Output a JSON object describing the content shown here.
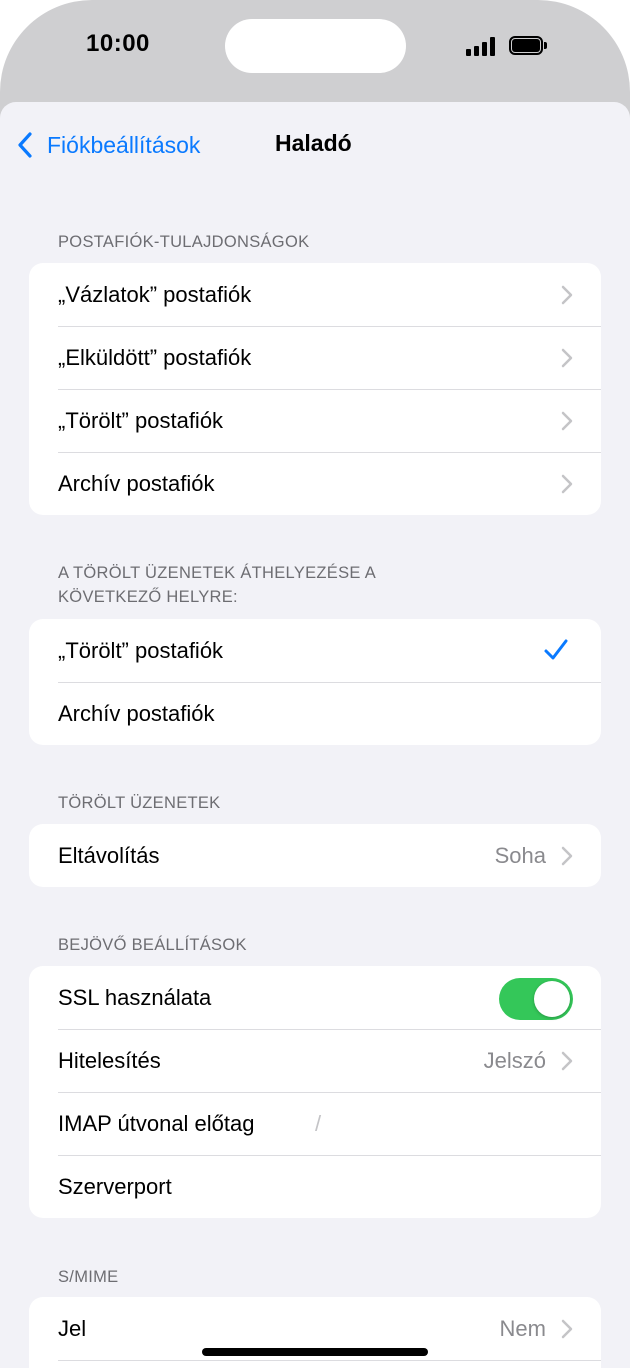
{
  "status_bar": {
    "time": "10:00"
  },
  "nav": {
    "back_label": "Fiókbeállítások",
    "title": "Haladó"
  },
  "sections": {
    "mailbox_props": {
      "header": "POSTAFIÓK-TULAJDONSÁGOK",
      "rows": [
        {
          "label": "„Vázlatok” postafiók"
        },
        {
          "label": "„Elküldött” postafiók"
        },
        {
          "label": "„Törölt” postafiók"
        },
        {
          "label": "Archív postafiók"
        }
      ]
    },
    "move_deleted": {
      "header_line1": "A TÖRÖLT ÜZENETEK ÁTHELYEZÉSE A",
      "header_line2": "KÖVETKEZŐ HELYRE:",
      "rows": [
        {
          "label": "„Törölt” postafiók",
          "selected": true
        },
        {
          "label": "Archív postafiók",
          "selected": false
        }
      ]
    },
    "deleted_messages": {
      "header": "TÖRÖLT ÜZENETEK",
      "rows": [
        {
          "label": "Eltávolítás",
          "value": "Soha"
        }
      ]
    },
    "incoming": {
      "header": "BEJÖVŐ BEÁLLÍTÁSOK",
      "rows": [
        {
          "label": "SSL használata",
          "toggle_on": true
        },
        {
          "label": "Hitelesítés",
          "value": "Jelszó"
        },
        {
          "label": "IMAP útvonal előtag",
          "placeholder": "/"
        },
        {
          "label": "Szerverport"
        }
      ]
    },
    "smime": {
      "header": "S/MIME",
      "rows": [
        {
          "label": "Jel",
          "value": "Nem"
        }
      ]
    }
  },
  "colors": {
    "accent": "#0a7aff",
    "toggle_on": "#34c759",
    "background": "#f2f2f7"
  }
}
